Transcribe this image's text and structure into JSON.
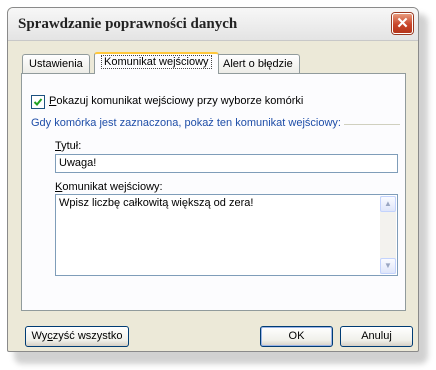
{
  "dialog": {
    "title": "Sprawdzanie poprawności danych",
    "close_glyph": "✕"
  },
  "tabs": [
    {
      "label": "Ustawienia",
      "active": false
    },
    {
      "label": "Komunikat wejściowy",
      "active": true
    },
    {
      "label": "Alert o błędzie",
      "active": false
    }
  ],
  "input_message": {
    "checkbox_checked": true,
    "checkbox_label_underlined": "P",
    "checkbox_label_rest": "okazuj komunikat wejściowy przy wyborze komórki",
    "group_label": "Gdy komórka jest zaznaczona, pokaż ten komunikat wejściowy:",
    "title_label_underlined": "T",
    "title_label_rest": "ytuł:",
    "title_value": "Uwaga!",
    "message_label_underlined": "K",
    "message_label_rest": "omunikat wejściowy:",
    "message_value": "Wpisz liczbę całkowitą większą od  zera!"
  },
  "buttons": {
    "clear_underlined_prefix": "Wy",
    "clear_underlined": "c",
    "clear_rest": "zyść wszystko",
    "ok": "OK",
    "cancel": "Anuluj"
  },
  "icons": {
    "check": "checkmark-icon",
    "close": "close-icon",
    "scroll_up": "scroll-up-arrow-icon",
    "scroll_down": "scroll-down-arrow-icon"
  }
}
